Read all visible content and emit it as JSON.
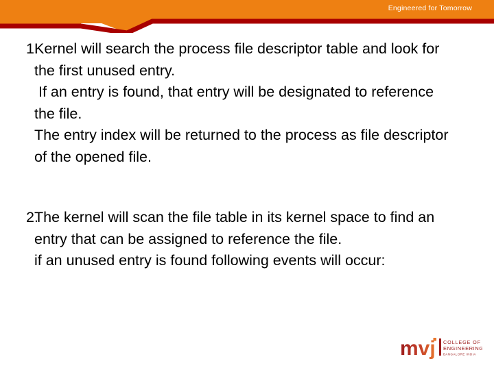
{
  "header": {
    "tagline": "Engineered for Tomorrow",
    "orange": "#ee8012",
    "dark_red": "#a80000"
  },
  "content": {
    "items": [
      {
        "marker": "1.",
        "paragraphs": [
          "Kernel will search the process file descriptor table and look for the first unused entry.",
          " If an entry is found, that entry will be designated to reference the file.",
          "The entry index will be returned to the process as file descriptor of the opened file."
        ]
      },
      {
        "marker": "2.",
        "paragraphs": [
          "The kernel will scan the file table in its kernel space to find an entry that can be assigned to reference the file.",
          "if an unused entry is found following events will occur:"
        ]
      }
    ]
  },
  "logo": {
    "wordmark": "mvj",
    "line1": "COLLEGE OF",
    "line2": "ENGINEERING",
    "line3": "BANGALORE INDIA",
    "color_dark": "#9c1b1b",
    "color_light": "#e8762c"
  }
}
